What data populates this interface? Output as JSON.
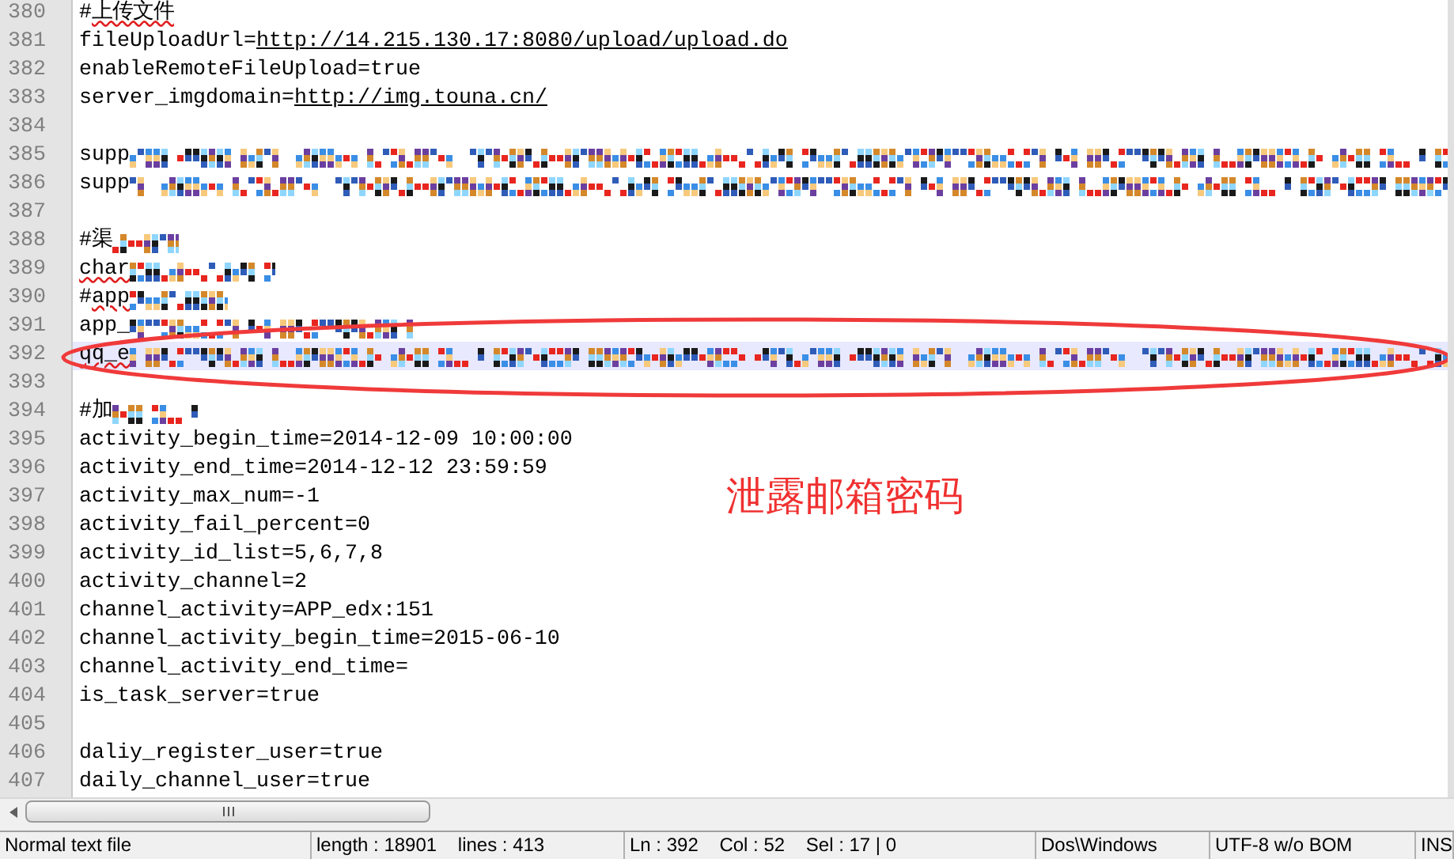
{
  "editor": {
    "lines": [
      {
        "number": "380",
        "current": false,
        "segments": [
          {
            "kind": "text",
            "text": "#"
          },
          {
            "kind": "misspelled",
            "text": "上传文件"
          }
        ]
      },
      {
        "number": "381",
        "current": false,
        "segments": [
          {
            "kind": "text",
            "text": "fileUploadUrl="
          },
          {
            "kind": "link",
            "text": "http://14.215.130.17:8080/upload/upload.do"
          }
        ]
      },
      {
        "number": "382",
        "current": false,
        "segments": [
          {
            "kind": "text",
            "text": "enableRemoteFileUpload=true"
          }
        ]
      },
      {
        "number": "383",
        "current": false,
        "segments": [
          {
            "kind": "text",
            "text": "server_imgdomain="
          },
          {
            "kind": "link",
            "text": "http://img.touna.cn/"
          }
        ]
      },
      {
        "number": "384",
        "current": false
      },
      {
        "number": "385",
        "current": false,
        "segments": [
          {
            "kind": "text",
            "text": "supp"
          },
          {
            "kind": "mosaic"
          }
        ]
      },
      {
        "number": "386",
        "current": false,
        "segments": [
          {
            "kind": "text",
            "text": "supp"
          },
          {
            "kind": "mosaic"
          }
        ]
      },
      {
        "number": "387",
        "current": false
      },
      {
        "number": "388",
        "current": false,
        "segments": [
          {
            "kind": "text",
            "text": "#渠"
          },
          {
            "kind": "mosaic"
          }
        ]
      },
      {
        "number": "389",
        "current": false,
        "segments": [
          {
            "kind": "misspelled",
            "text": "char"
          },
          {
            "kind": "mosaic"
          }
        ]
      },
      {
        "number": "390",
        "current": false,
        "segments": [
          {
            "kind": "text",
            "text": "#"
          },
          {
            "kind": "misspelled",
            "text": "app"
          },
          {
            "kind": "mosaic"
          }
        ]
      },
      {
        "number": "391",
        "current": false,
        "segments": [
          {
            "kind": "text",
            "text": "app_"
          },
          {
            "kind": "mosaic"
          }
        ]
      },
      {
        "number": "392",
        "current": true,
        "segments": [
          {
            "kind": "misspelled",
            "text": "qq_e"
          },
          {
            "kind": "mosaic"
          }
        ]
      },
      {
        "number": "393",
        "current": false
      },
      {
        "number": "394",
        "current": false,
        "segments": [
          {
            "kind": "text",
            "text": "#加"
          },
          {
            "kind": "mosaic"
          }
        ]
      },
      {
        "number": "395",
        "current": false,
        "segments": [
          {
            "kind": "text",
            "text": "activity_begin_time=2014-12-09 10:00:00"
          }
        ]
      },
      {
        "number": "396",
        "current": false,
        "segments": [
          {
            "kind": "text",
            "text": "activity_end_time=2014-12-12 23:59:59"
          }
        ]
      },
      {
        "number": "397",
        "current": false,
        "segments": [
          {
            "kind": "text",
            "text": "activity_max_num=-1"
          }
        ]
      },
      {
        "number": "398",
        "current": false,
        "segments": [
          {
            "kind": "text",
            "text": "activity_fail_percent=0"
          }
        ]
      },
      {
        "number": "399",
        "current": false,
        "segments": [
          {
            "kind": "text",
            "text": "activity_id_list=5,6,7,8"
          }
        ]
      },
      {
        "number": "400",
        "current": false,
        "segments": [
          {
            "kind": "text",
            "text": "activity_channel=2"
          }
        ]
      },
      {
        "number": "401",
        "current": false,
        "segments": [
          {
            "kind": "text",
            "text": "channel_activity=APP_edx:151"
          }
        ]
      },
      {
        "number": "402",
        "current": false,
        "segments": [
          {
            "kind": "text",
            "text": "channel_activity_begin_time=2015-06-10"
          }
        ]
      },
      {
        "number": "403",
        "current": false,
        "segments": [
          {
            "kind": "text",
            "text": "channel_activity_end_time="
          }
        ]
      },
      {
        "number": "404",
        "current": false,
        "segments": [
          {
            "kind": "text",
            "text": "is_task_server=true"
          }
        ]
      },
      {
        "number": "405",
        "current": false
      },
      {
        "number": "406",
        "current": false,
        "segments": [
          {
            "kind": "text",
            "text": "daliy_register_user=true"
          }
        ]
      },
      {
        "number": "407",
        "current": false,
        "segments": [
          {
            "kind": "text",
            "text": "daily_channel_user=true"
          }
        ]
      }
    ]
  },
  "annotation": {
    "text": "泄露邮箱密码"
  },
  "status_bar": [
    "Normal text file",
    "length : 18901    lines : 413",
    "Ln : 392    Col : 52    Sel : 17 | 0",
    "Dos\\Windows",
    "UTF-8 w/o BOM",
    "INS"
  ]
}
